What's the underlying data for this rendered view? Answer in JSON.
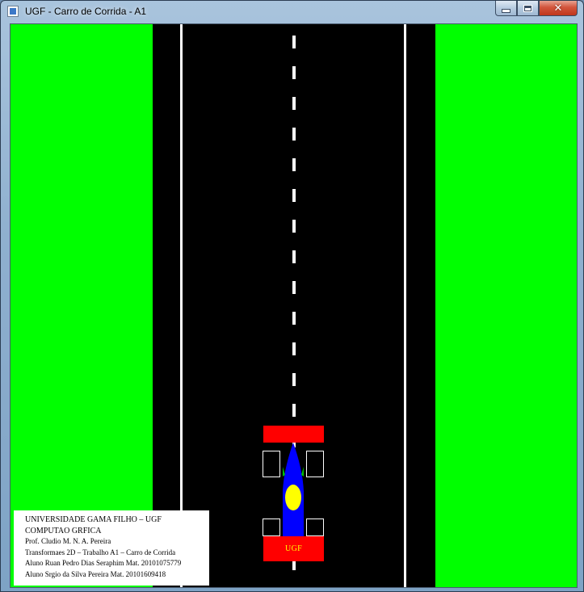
{
  "window": {
    "title": "UGF - Carro de Corrida - A1",
    "controls": {
      "minimize": "minimize-icon",
      "maximize": "maximize-icon",
      "close": "close-icon"
    }
  },
  "scene": {
    "colors": {
      "grass": "#00ff00",
      "road": "#000000",
      "lane_markings": "#ffffff",
      "car_wings": "#ff0000",
      "car_body": "#0000ff",
      "driver_helmet": "#ffff00",
      "label_text": "#ffff00"
    },
    "car": {
      "label": "UGF"
    }
  },
  "info_panel": {
    "line1": "UNIVERSIDADE GAMA FILHO – UGF",
    "line2": "COMPUTAO GRFICA",
    "line3": "Prof. Cludio M. N. A. Pereira",
    "line4": "Transformaes 2D – Trabalho A1 – Carro de Corrida",
    "line5": "Aluno Ruan Pedro Dias Seraphim Mat. 20101075779",
    "line6": "Aluno Srgio da Silva Pereira  Mat. 20101609418"
  }
}
